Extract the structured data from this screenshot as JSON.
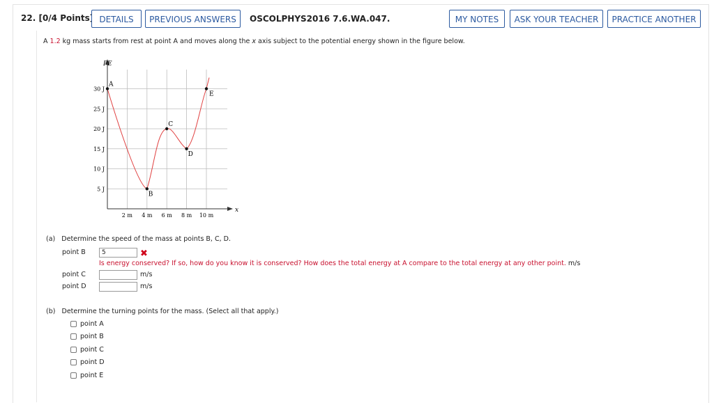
{
  "header": {
    "question_number": "22.",
    "points": "[0/4 Points]",
    "details_label": "DETAILS",
    "previous_answers_label": "PREVIOUS ANSWERS",
    "question_code": "OSCOLPHYS2016 7.6.WA.047.",
    "my_notes_label": "MY NOTES",
    "ask_teacher_label": "ASK YOUR TEACHER",
    "practice_another_label": "PRACTICE ANOTHER"
  },
  "prompt": {
    "before": "A ",
    "mass_value": "1.2",
    "after": " kg mass starts from rest at point A and moves along the ",
    "axis_var": "x",
    "end": " axis subject to the potential energy shown in the figure below."
  },
  "figure": {
    "y_axis_label": "PE",
    "x_axis_label": "x",
    "y_ticks": [
      "30 J",
      "25 J",
      "20 J",
      "15 J",
      "10 J",
      "5 J"
    ],
    "x_ticks": [
      "2 m",
      "4 m",
      "6 m",
      "8 m",
      "10 m"
    ],
    "points": [
      {
        "label": "A",
        "x_m": 0,
        "pe_j": 30
      },
      {
        "label": "B",
        "x_m": 4,
        "pe_j": 5
      },
      {
        "label": "C",
        "x_m": 6,
        "pe_j": 20
      },
      {
        "label": "D",
        "x_m": 8,
        "pe_j": 15
      },
      {
        "label": "E",
        "x_m": 10,
        "pe_j": 30
      }
    ],
    "curve_color": "#e04040"
  },
  "part_a": {
    "prefix": "(a)",
    "text": "Determine the speed of the mass at points B, C, D.",
    "rows": [
      {
        "label": "point B",
        "value": "5",
        "unit": ""
      },
      {
        "label": "point C",
        "value": "",
        "unit": "m/s"
      },
      {
        "label": "point D",
        "value": "",
        "unit": "m/s"
      }
    ],
    "feedback": "Is energy conserved? If so, how do you know it is conserved? How does the total energy at A compare to the total energy at any other point.",
    "feedback_unit": "m/s"
  },
  "part_b": {
    "prefix": "(b)",
    "text": "Determine the turning points for the mass. (Select all that apply.)",
    "options": [
      "point A",
      "point B",
      "point C",
      "point D",
      "point E"
    ]
  }
}
